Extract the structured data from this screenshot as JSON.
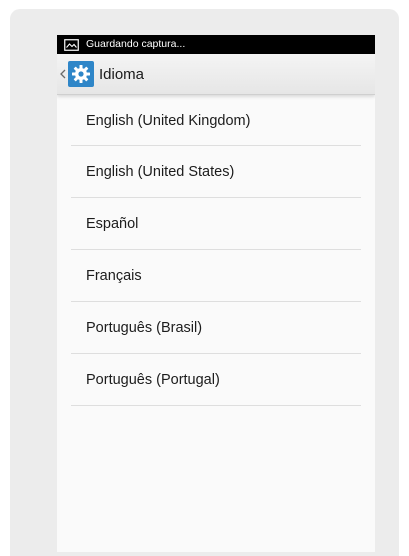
{
  "status_bar": {
    "notification_text": "Guardando captura..."
  },
  "action_bar": {
    "title": "Idioma"
  },
  "languages": [
    {
      "label": "English (United Kingdom)"
    },
    {
      "label": "English (United States)"
    },
    {
      "label": "Español"
    },
    {
      "label": "Français"
    },
    {
      "label": "Português (Brasil)"
    },
    {
      "label": "Português (Portugal)"
    }
  ],
  "colors": {
    "accent": "#2f86c8",
    "status_bar": "#000000"
  }
}
